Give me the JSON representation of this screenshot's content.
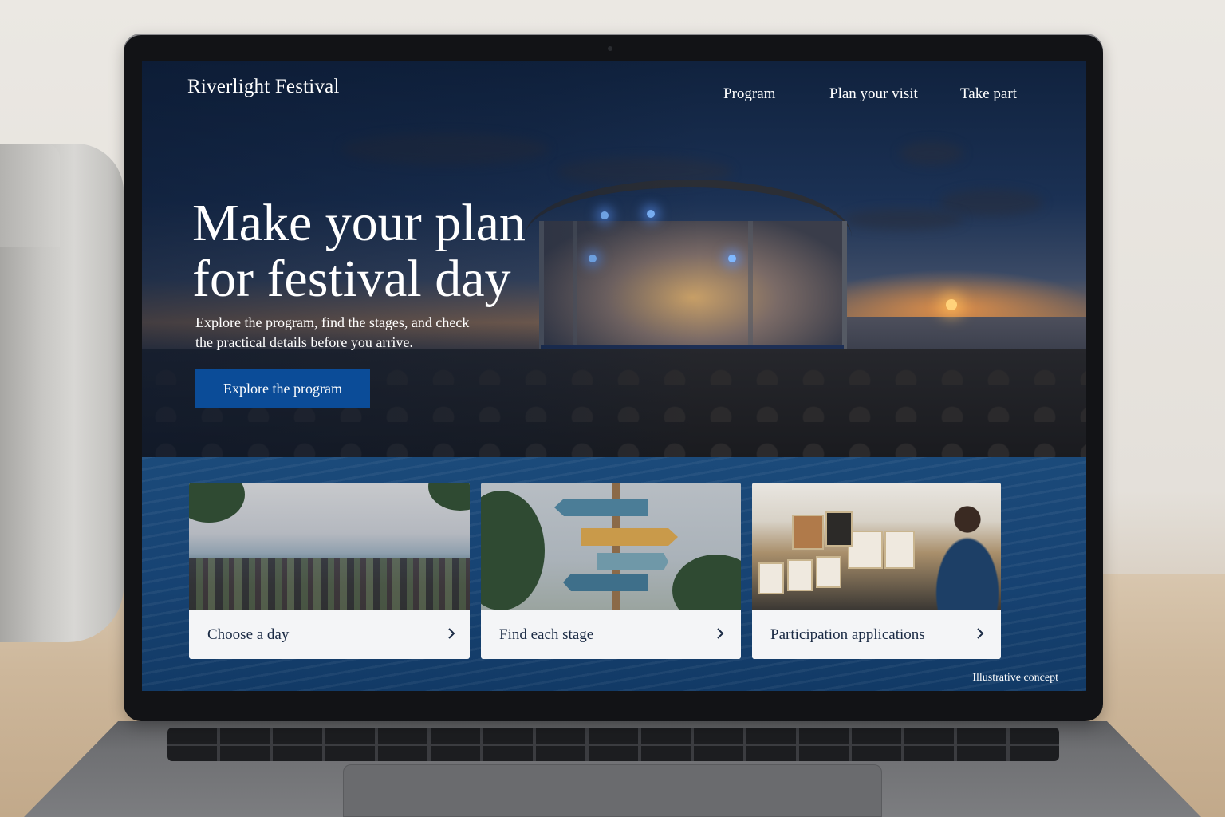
{
  "site": {
    "brand": "Riverlight Festival",
    "nav": [
      "Program",
      "Plan your visit",
      "Take part"
    ]
  },
  "hero": {
    "headline_line1": "Make your plan",
    "headline_line2": "for festival day",
    "subtext_line1": "Explore the program, find the stages, and check",
    "subtext_line2": "the practical details before you arrive.",
    "cta_label": "Explore the program"
  },
  "cards": [
    {
      "label": "Choose a day",
      "icon": "chevron-right-icon"
    },
    {
      "label": "Find each stage",
      "icon": "chevron-right-icon"
    },
    {
      "label": "Participation applications",
      "icon": "chevron-right-icon"
    }
  ],
  "caption": "Illustrative concept",
  "colors": {
    "cta_background": "#0b4c98",
    "card_background": "#f4f5f7",
    "card_text": "#1a2a44",
    "water": "#174373"
  }
}
